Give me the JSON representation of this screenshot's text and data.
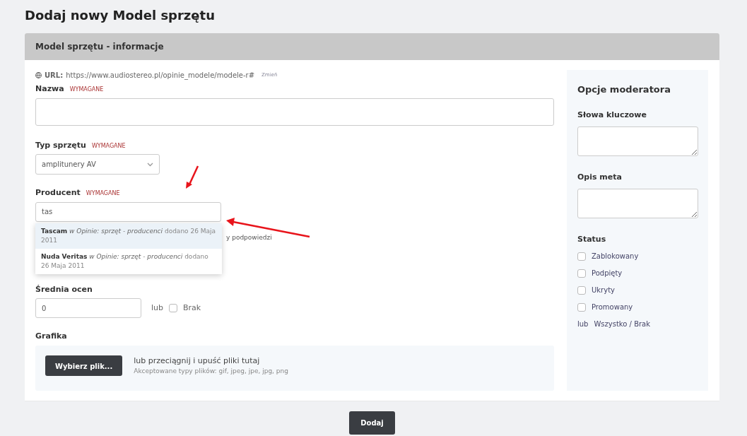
{
  "page_title": "Dodaj nowy Model sprzętu",
  "card_header": "Model sprzętu - informacje",
  "url": {
    "label": "URL:",
    "value": "https://www.audiostereo.pl/opinie_modele/modele-r#",
    "change_link": "Zmień"
  },
  "name_field": {
    "label": "Nazwa",
    "required": "WYMAGANE"
  },
  "type_field": {
    "label": "Typ sprzętu",
    "required": "WYMAGANE",
    "value": "amplitunery AV"
  },
  "producer_field": {
    "label": "Producent",
    "required": "WYMAGANE",
    "value": "tas",
    "hint": "y podpowiedzi"
  },
  "suggestions": [
    {
      "name": "Tascam",
      "category": "w Opinie: sprzęt - producenci",
      "added": "dodano 26 Maja 2011",
      "selected": true
    },
    {
      "name": "Nuda Veritas",
      "category": "w Opinie: sprzęt - producenci",
      "added": "dodano 26 Maja 2011",
      "selected": false
    }
  ],
  "rating_field": {
    "label": "Średnia ocen",
    "value": "0",
    "or": "lub",
    "none_label": "Brak",
    "none_checked": false
  },
  "graphics": {
    "label": "Grafika",
    "button": "Wybierz plik...",
    "drop_text": "lub przeciągnij i upuść pliki tutaj",
    "accepted": "Akceptowane typy plików: gif, jpeg, jpe, jpg, png"
  },
  "moderator": {
    "title": "Opcje moderatora",
    "keywords_label": "Słowa kluczowe",
    "meta_label": "Opis meta",
    "status_label": "Status",
    "statuses": [
      {
        "label": "Zablokowany",
        "checked": false
      },
      {
        "label": "Podpięty",
        "checked": false
      },
      {
        "label": "Ukryty",
        "checked": false
      },
      {
        "label": "Promowany",
        "checked": false
      }
    ],
    "or": "lub",
    "all_none": "Wszystko / Brak"
  },
  "submit": "Dodaj"
}
